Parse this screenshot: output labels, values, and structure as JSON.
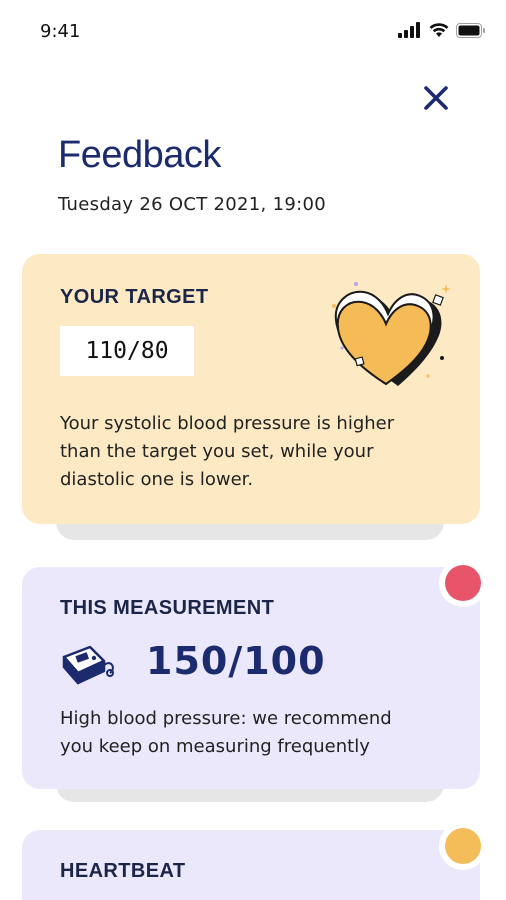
{
  "status_bar": {
    "time": "9:41",
    "icons": [
      "signal-icon",
      "wifi-icon",
      "battery-icon"
    ]
  },
  "header": {
    "close_icon": "close-icon",
    "title": "Feedback",
    "date": "Tuesday 26 OCT 2021, 19:00"
  },
  "cards": {
    "target": {
      "title": "YOUR TARGET",
      "value": "110/80",
      "text_line1": "Your systolic blood pressure is higher",
      "text_line2": "than the target you set, while your",
      "text_line3": "diastolic one is lower.",
      "illustration": "heart-illustration",
      "background": "#fde9c4"
    },
    "measurement": {
      "title": "THIS MEASUREMENT",
      "value": "150/100",
      "icon": "blood-pressure-monitor-icon",
      "text_line1": "High blood pressure: we recommend",
      "text_line2": "you keep on measuring frequently",
      "status_color": "#e8556a",
      "background": "#ebe8fb"
    },
    "heartbeat": {
      "title": "HEARTBEAT",
      "status_color": "#f5bd5a",
      "background": "#ebe8fb"
    }
  },
  "colors": {
    "primary_navy": "#1c2a6e",
    "text_dark": "#222222"
  }
}
